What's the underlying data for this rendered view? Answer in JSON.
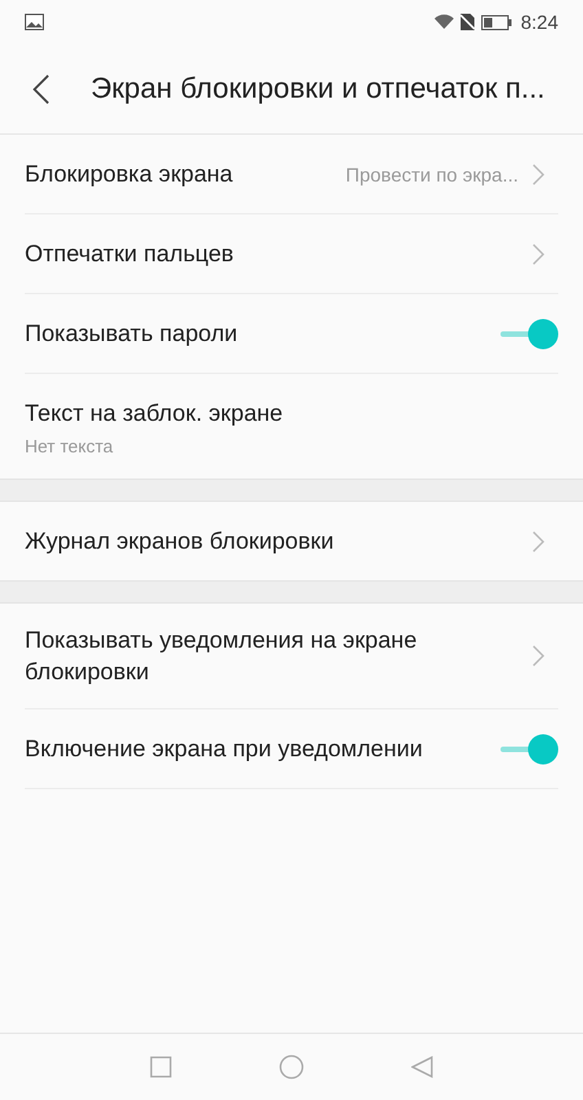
{
  "status_bar": {
    "time": "8:24"
  },
  "header": {
    "title": "Экран блокировки и отпечаток п..."
  },
  "sections": [
    {
      "rows": [
        {
          "kind": "link",
          "label": "Блокировка экрана",
          "value": "Провести по экра..."
        },
        {
          "kind": "link",
          "label": "Отпечатки пальцев"
        },
        {
          "kind": "toggle",
          "label": "Показывать пароли",
          "on": true
        },
        {
          "kind": "text",
          "label": "Текст на заблок. экране",
          "subtitle": "Нет текста"
        }
      ]
    },
    {
      "rows": [
        {
          "kind": "link",
          "label": "Журнал экранов блокировки"
        }
      ]
    },
    {
      "rows": [
        {
          "kind": "link",
          "label": "Показывать уведомления на экране блокировки"
        },
        {
          "kind": "toggle",
          "label": "Включение экрана при уведомлении",
          "on": true
        }
      ]
    }
  ]
}
